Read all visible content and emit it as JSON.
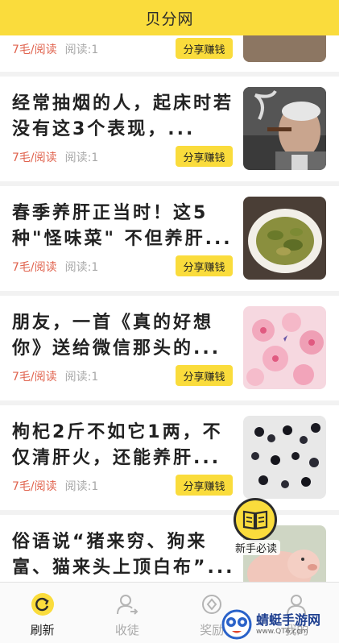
{
  "header": {
    "title": "贝分网"
  },
  "feed": {
    "partial_card": {
      "rate": "7毛/阅读",
      "reads": "阅读:1",
      "share_label": "分享赚钱"
    },
    "cards": [
      {
        "headline": "经常抽烟的人，起床时若没有这3个表现，...",
        "rate": "7毛/阅读",
        "reads": "阅读:1",
        "share_label": "分享赚钱",
        "thumb": "smoking-man-photo"
      },
      {
        "headline": "春季养肝正当时！这5种\"怪味菜\" 不但养肝...",
        "rate": "7毛/阅读",
        "reads": "阅读:1",
        "share_label": "分享赚钱",
        "thumb": "vegetable-dish-photo"
      },
      {
        "headline": "朋友，一首《真的好想你》送给微信那头的...",
        "rate": "7毛/阅读",
        "reads": "阅读:1",
        "share_label": "分享赚钱",
        "thumb": "cherry-blossom-photo"
      },
      {
        "headline": "枸杞2斤不如它1两，不仅清肝火，还能养肝...",
        "rate": "7毛/阅读",
        "reads": "阅读:1",
        "share_label": "分享赚钱",
        "thumb": "black-goji-photo"
      },
      {
        "headline": "俗语说“猪来穷、狗来富、猫来头上顶白布”...",
        "thumb": "piglet-photo"
      }
    ]
  },
  "fab": {
    "label": "新手必读",
    "icon": "book-icon"
  },
  "tabbar": {
    "tabs": [
      {
        "label": "刷新",
        "icon": "refresh-icon",
        "active": true
      },
      {
        "label": "收徒",
        "icon": "add-user-icon",
        "active": false
      },
      {
        "label": "奖励",
        "icon": "reward-icon",
        "active": false
      },
      {
        "label": "我的",
        "icon": "profile-icon",
        "active": false
      }
    ]
  },
  "watermark": {
    "name": "蜻蜓手游网",
    "url": "www.QT6.com"
  },
  "colors": {
    "brand": "#fadc3c",
    "rate": "#e0634e",
    "muted": "#a8a8a8"
  }
}
